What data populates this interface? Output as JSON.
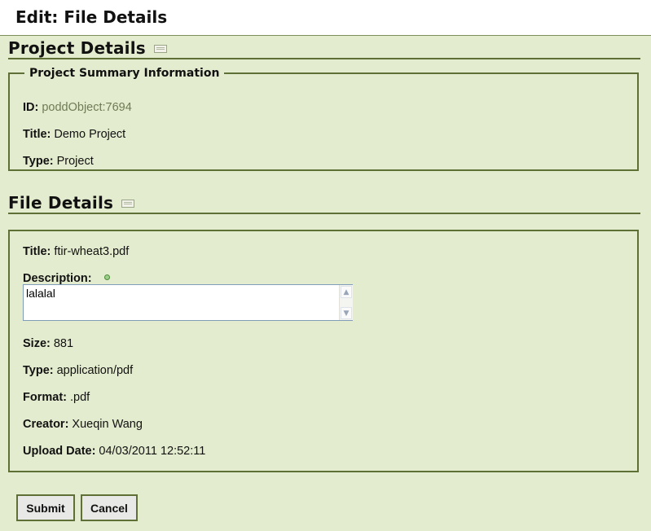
{
  "page": {
    "title": "Edit: File Details"
  },
  "project_section": {
    "heading": "Project Details",
    "legend": "Project Summary Information",
    "fields": [
      {
        "label": "ID:",
        "value": "poddObject:7694"
      },
      {
        "label": "Title:",
        "value": "Demo Project"
      },
      {
        "label": "Type:",
        "value": "Project"
      }
    ]
  },
  "file_section": {
    "heading": "File Details",
    "title": {
      "label": "Title:",
      "value": "ftir-wheat3.pdf"
    },
    "description": {
      "label": "Description:",
      "value": "lalalal"
    },
    "fields": [
      {
        "label": "Size:",
        "value": "881"
      },
      {
        "label": "Type:",
        "value": "application/pdf"
      },
      {
        "label": "Format:",
        "value": ".pdf"
      },
      {
        "label": "Creator:",
        "value": "Xueqin Wang"
      },
      {
        "label": "Upload Date:",
        "value": "04/03/2011 12:52:11"
      }
    ]
  },
  "buttons": {
    "submit": "Submit",
    "cancel": "Cancel"
  },
  "icons": {
    "section_toggle": "keyboard-icon",
    "required": "required-dot-icon"
  },
  "colors": {
    "background": "#e3ecce",
    "border": "#5e7036",
    "muted_text": "#6f7b56"
  }
}
